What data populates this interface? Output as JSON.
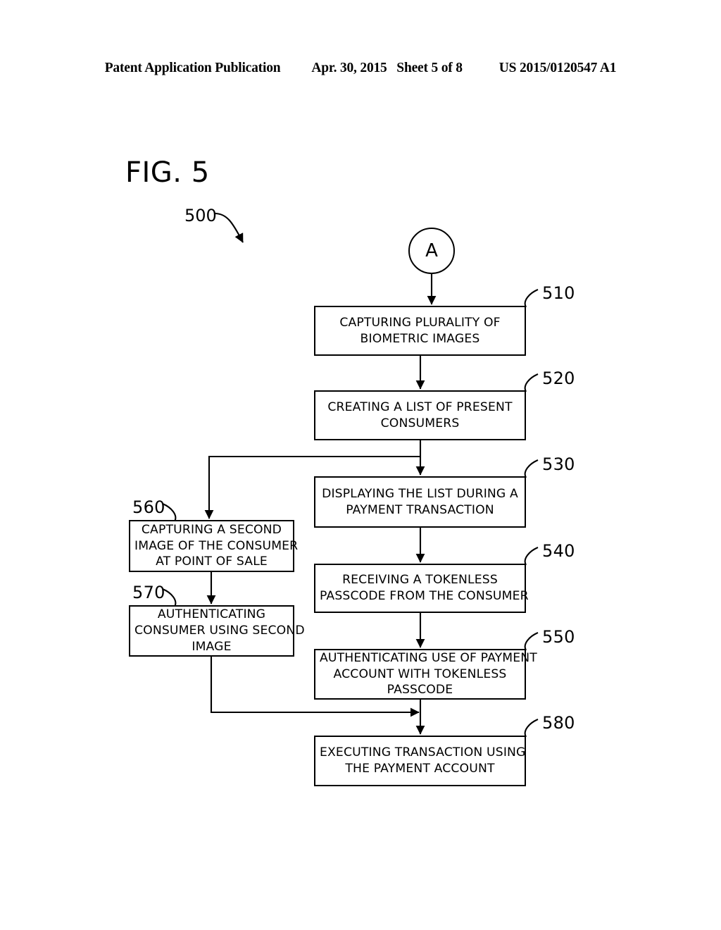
{
  "header": {
    "publication": "Patent Application Publication",
    "date": "Apr. 30, 2015",
    "sheet": "Sheet 5 of 8",
    "number": "US 2015/0120547 A1"
  },
  "figure": {
    "label": "FIG. 5",
    "overall_ref": "500",
    "connector": {
      "label": "A",
      "ref_name": "connector-a"
    }
  },
  "nodes": [
    {
      "ref": "510",
      "ref_side": "right",
      "lines": [
        "CAPTURING PLURALITY OF",
        "BIOMETRIC IMAGES"
      ],
      "column": "right"
    },
    {
      "ref": "520",
      "ref_side": "right",
      "lines": [
        "CREATING A LIST OF PRESENT",
        "CONSUMERS"
      ],
      "column": "right"
    },
    {
      "ref": "530",
      "ref_side": "right",
      "lines": [
        "DISPLAYING THE LIST DURING A",
        "PAYMENT TRANSACTION"
      ],
      "column": "right"
    },
    {
      "ref": "540",
      "ref_side": "right",
      "lines": [
        "RECEIVING A TOKENLESS",
        "PASSCODE FROM THE CONSUMER"
      ],
      "column": "right"
    },
    {
      "ref": "550",
      "ref_side": "right",
      "lines": [
        "AUTHENTICATING USE OF PAYMENT",
        "ACCOUNT WITH TOKENLESS",
        "PASSCODE"
      ],
      "column": "right"
    },
    {
      "ref": "580",
      "ref_side": "right",
      "lines": [
        "EXECUTING TRANSACTION USING",
        "THE PAYMENT ACCOUNT"
      ],
      "column": "right"
    },
    {
      "ref": "560",
      "ref_side": "left",
      "lines": [
        "CAPTURING A SECOND",
        "IMAGE OF THE CONSUMER",
        "AT POINT OF SALE"
      ],
      "column": "left"
    },
    {
      "ref": "570",
      "ref_side": "left",
      "lines": [
        "AUTHENTICATING",
        "CONSUMER USING SECOND",
        "IMAGE"
      ],
      "column": "left"
    }
  ],
  "text": {
    "n510_l1": "CAPTURING PLURALITY OF",
    "n510_l2": "BIOMETRIC IMAGES",
    "n520_l1": "CREATING A LIST OF PRESENT",
    "n520_l2": "CONSUMERS",
    "n530_l1": "DISPLAYING THE LIST DURING A",
    "n530_l2": "PAYMENT TRANSACTION",
    "n540_l1": "RECEIVING A TOKENLESS",
    "n540_l2": "PASSCODE FROM THE CONSUMER",
    "n550_l1": "AUTHENTICATING USE OF PAYMENT",
    "n550_l2": "ACCOUNT WITH TOKENLESS",
    "n550_l3": "PASSCODE",
    "n580_l1": "EXECUTING TRANSACTION USING",
    "n580_l2": "THE PAYMENT ACCOUNT",
    "n560_l1": "CAPTURING A SECOND",
    "n560_l2": "IMAGE OF THE CONSUMER",
    "n560_l3": "AT POINT OF SALE",
    "n570_l1": "AUTHENTICATING",
    "n570_l2": "CONSUMER USING SECOND",
    "n570_l3": "IMAGE"
  },
  "refs": {
    "r510": "510",
    "r520": "520",
    "r530": "530",
    "r540": "540",
    "r550": "550",
    "r560": "560",
    "r570": "570",
    "r580": "580"
  },
  "colors": {
    "ink": "#000000",
    "paper": "#ffffff"
  }
}
